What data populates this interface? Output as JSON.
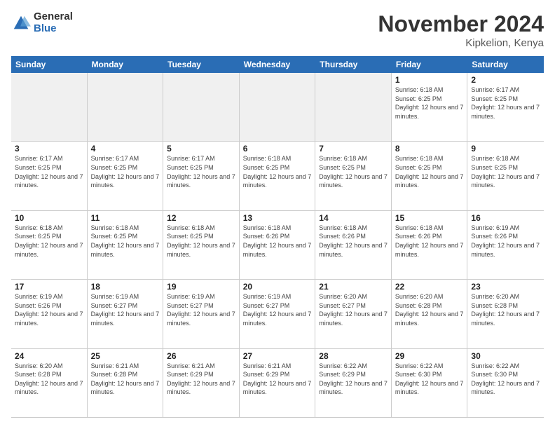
{
  "logo": {
    "general": "General",
    "blue": "Blue"
  },
  "title": "November 2024",
  "location": "Kipkelion, Kenya",
  "header_days": [
    "Sunday",
    "Monday",
    "Tuesday",
    "Wednesday",
    "Thursday",
    "Friday",
    "Saturday"
  ],
  "weeks": [
    [
      {
        "day": "",
        "info": "",
        "empty": true
      },
      {
        "day": "",
        "info": "",
        "empty": true
      },
      {
        "day": "",
        "info": "",
        "empty": true
      },
      {
        "day": "",
        "info": "",
        "empty": true
      },
      {
        "day": "",
        "info": "",
        "empty": true
      },
      {
        "day": "1",
        "info": "Sunrise: 6:18 AM\nSunset: 6:25 PM\nDaylight: 12 hours and 7 minutes."
      },
      {
        "day": "2",
        "info": "Sunrise: 6:17 AM\nSunset: 6:25 PM\nDaylight: 12 hours and 7 minutes."
      }
    ],
    [
      {
        "day": "3",
        "info": "Sunrise: 6:17 AM\nSunset: 6:25 PM\nDaylight: 12 hours and 7 minutes."
      },
      {
        "day": "4",
        "info": "Sunrise: 6:17 AM\nSunset: 6:25 PM\nDaylight: 12 hours and 7 minutes."
      },
      {
        "day": "5",
        "info": "Sunrise: 6:17 AM\nSunset: 6:25 PM\nDaylight: 12 hours and 7 minutes."
      },
      {
        "day": "6",
        "info": "Sunrise: 6:18 AM\nSunset: 6:25 PM\nDaylight: 12 hours and 7 minutes."
      },
      {
        "day": "7",
        "info": "Sunrise: 6:18 AM\nSunset: 6:25 PM\nDaylight: 12 hours and 7 minutes."
      },
      {
        "day": "8",
        "info": "Sunrise: 6:18 AM\nSunset: 6:25 PM\nDaylight: 12 hours and 7 minutes."
      },
      {
        "day": "9",
        "info": "Sunrise: 6:18 AM\nSunset: 6:25 PM\nDaylight: 12 hours and 7 minutes."
      }
    ],
    [
      {
        "day": "10",
        "info": "Sunrise: 6:18 AM\nSunset: 6:25 PM\nDaylight: 12 hours and 7 minutes."
      },
      {
        "day": "11",
        "info": "Sunrise: 6:18 AM\nSunset: 6:25 PM\nDaylight: 12 hours and 7 minutes."
      },
      {
        "day": "12",
        "info": "Sunrise: 6:18 AM\nSunset: 6:25 PM\nDaylight: 12 hours and 7 minutes."
      },
      {
        "day": "13",
        "info": "Sunrise: 6:18 AM\nSunset: 6:26 PM\nDaylight: 12 hours and 7 minutes."
      },
      {
        "day": "14",
        "info": "Sunrise: 6:18 AM\nSunset: 6:26 PM\nDaylight: 12 hours and 7 minutes."
      },
      {
        "day": "15",
        "info": "Sunrise: 6:18 AM\nSunset: 6:26 PM\nDaylight: 12 hours and 7 minutes."
      },
      {
        "day": "16",
        "info": "Sunrise: 6:19 AM\nSunset: 6:26 PM\nDaylight: 12 hours and 7 minutes."
      }
    ],
    [
      {
        "day": "17",
        "info": "Sunrise: 6:19 AM\nSunset: 6:26 PM\nDaylight: 12 hours and 7 minutes."
      },
      {
        "day": "18",
        "info": "Sunrise: 6:19 AM\nSunset: 6:27 PM\nDaylight: 12 hours and 7 minutes."
      },
      {
        "day": "19",
        "info": "Sunrise: 6:19 AM\nSunset: 6:27 PM\nDaylight: 12 hours and 7 minutes."
      },
      {
        "day": "20",
        "info": "Sunrise: 6:19 AM\nSunset: 6:27 PM\nDaylight: 12 hours and 7 minutes."
      },
      {
        "day": "21",
        "info": "Sunrise: 6:20 AM\nSunset: 6:27 PM\nDaylight: 12 hours and 7 minutes."
      },
      {
        "day": "22",
        "info": "Sunrise: 6:20 AM\nSunset: 6:28 PM\nDaylight: 12 hours and 7 minutes."
      },
      {
        "day": "23",
        "info": "Sunrise: 6:20 AM\nSunset: 6:28 PM\nDaylight: 12 hours and 7 minutes."
      }
    ],
    [
      {
        "day": "24",
        "info": "Sunrise: 6:20 AM\nSunset: 6:28 PM\nDaylight: 12 hours and 7 minutes."
      },
      {
        "day": "25",
        "info": "Sunrise: 6:21 AM\nSunset: 6:28 PM\nDaylight: 12 hours and 7 minutes."
      },
      {
        "day": "26",
        "info": "Sunrise: 6:21 AM\nSunset: 6:29 PM\nDaylight: 12 hours and 7 minutes."
      },
      {
        "day": "27",
        "info": "Sunrise: 6:21 AM\nSunset: 6:29 PM\nDaylight: 12 hours and 7 minutes."
      },
      {
        "day": "28",
        "info": "Sunrise: 6:22 AM\nSunset: 6:29 PM\nDaylight: 12 hours and 7 minutes."
      },
      {
        "day": "29",
        "info": "Sunrise: 6:22 AM\nSunset: 6:30 PM\nDaylight: 12 hours and 7 minutes."
      },
      {
        "day": "30",
        "info": "Sunrise: 6:22 AM\nSunset: 6:30 PM\nDaylight: 12 hours and 7 minutes."
      }
    ]
  ]
}
